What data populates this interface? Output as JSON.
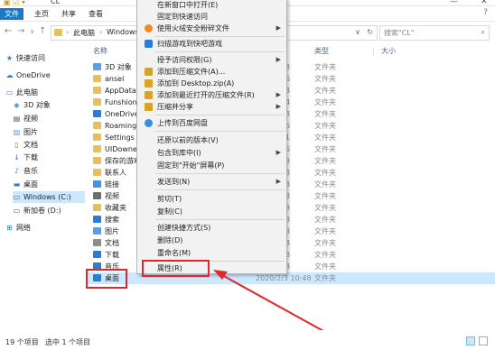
{
  "window": {
    "title": "CL",
    "minimize": "—",
    "close": "✕"
  },
  "ribbon": {
    "tabs": [
      "文件",
      "主页",
      "共享",
      "查看"
    ],
    "help": "?"
  },
  "address": {
    "crumbs": [
      "此电脑",
      "Windows"
    ],
    "search_placeholder": "搜索\"CL\""
  },
  "navpane": {
    "items": [
      {
        "label": "快速访问",
        "icon": "star-icon"
      },
      {
        "label": "OneDrive",
        "icon": "cloud-icon"
      },
      {
        "label": "此电脑",
        "icon": "computer-icon"
      },
      {
        "label": "3D 对象",
        "icon": "cube-icon"
      },
      {
        "label": "视频",
        "icon": "video-icon"
      },
      {
        "label": "图片",
        "icon": "picture-icon"
      },
      {
        "label": "文档",
        "icon": "document-icon"
      },
      {
        "label": "下载",
        "icon": "download-icon"
      },
      {
        "label": "音乐",
        "icon": "music-icon"
      },
      {
        "label": "桌面",
        "icon": "desktop-icon"
      },
      {
        "label": "Windows (C:)",
        "icon": "drive-icon"
      },
      {
        "label": "新加卷 (D:)",
        "icon": "drive-icon"
      },
      {
        "label": "网络",
        "icon": "network-icon"
      }
    ]
  },
  "columns": {
    "name": "名称",
    "type": "类型",
    "size": "大小"
  },
  "files": [
    {
      "name": "3D 对象",
      "tail": "3",
      "type": "文件夹",
      "color": "#5aa0e0"
    },
    {
      "name": "ansel",
      "tail": "6",
      "type": "文件夹",
      "color": "#e8c05b"
    },
    {
      "name": "AppData",
      "tail": "3",
      "type": "文件夹",
      "color": "#e8c05b"
    },
    {
      "name": "Funshion",
      "tail": "4",
      "type": "文件夹",
      "color": "#e8c05b"
    },
    {
      "name": "OneDrive",
      "tail": "3",
      "type": "文件夹",
      "color": "#2b7cd3"
    },
    {
      "name": "Roaming",
      "tail": "6",
      "type": "文件夹",
      "color": "#e8c05b"
    },
    {
      "name": "Settings",
      "tail": "1",
      "type": "文件夹",
      "color": "#e8c05b"
    },
    {
      "name": "UIDowner",
      "tail": "6",
      "type": "文件夹",
      "color": "#e8c05b"
    },
    {
      "name": "保存的游戏",
      "tail": "3",
      "type": "文件夹",
      "color": "#e8c05b"
    },
    {
      "name": "联系人",
      "tail": "3",
      "type": "文件夹",
      "color": "#e8c05b"
    },
    {
      "name": "链接",
      "tail": "3",
      "type": "文件夹",
      "color": "#4a90d9"
    },
    {
      "name": "视频",
      "tail": "3",
      "type": "文件夹",
      "color": "#6d6d6d"
    },
    {
      "name": "收藏夹",
      "tail": "3",
      "type": "文件夹",
      "color": "#e8c05b"
    },
    {
      "name": "搜索",
      "tail": "3",
      "type": "文件夹",
      "color": "#2b7cd3"
    },
    {
      "name": "图片",
      "tail": "3",
      "type": "文件夹",
      "color": "#5aa0e0"
    },
    {
      "name": "文档",
      "tail": "3",
      "type": "文件夹",
      "color": "#8c8c8c"
    },
    {
      "name": "下载",
      "tail": "3",
      "type": "文件夹",
      "color": "#2b7cd3"
    },
    {
      "name": "音乐",
      "tail": "3",
      "type": "文件夹",
      "color": "#2b7cd3"
    },
    {
      "name": "桌面",
      "date": "2020/2/3 10:48",
      "type": "文件夹",
      "color": "#2b7cd3"
    }
  ],
  "context_menu": {
    "items": [
      {
        "label": "在新窗口中打开(E)",
        "icon": "",
        "submenu": false
      },
      {
        "label": "固定到快速访问",
        "icon": "",
        "submenu": false
      },
      {
        "label": "使用火绒安全粉碎文件",
        "icon": "shield-icon",
        "submenu": true
      },
      {
        "label": "扫描游戏到快吧游戏",
        "icon": "game-icon",
        "submenu": false
      },
      {
        "label": "授予访问权限(G)",
        "icon": "",
        "submenu": true
      },
      {
        "label": "添加到压缩文件(A)...",
        "icon": "archive-icon",
        "submenu": false
      },
      {
        "label": "添加到 Desktop.zip(A)",
        "icon": "archive-icon",
        "submenu": false
      },
      {
        "label": "添加到最近打开的压缩文件(R)",
        "icon": "archive-icon",
        "submenu": true
      },
      {
        "label": "压缩并分享",
        "icon": "archive-icon",
        "submenu": true
      },
      {
        "label": "上传到百度网盘",
        "icon": "cloud-upload-icon",
        "submenu": false
      },
      {
        "label": "还原以前的版本(V)",
        "icon": "",
        "submenu": false
      },
      {
        "label": "包含到库中(I)",
        "icon": "",
        "submenu": true
      },
      {
        "label": "固定到\"开始\"屏幕(P)",
        "icon": "",
        "submenu": false
      },
      {
        "label": "发送到(N)",
        "icon": "",
        "submenu": true
      },
      {
        "label": "剪切(T)",
        "icon": "",
        "submenu": false
      },
      {
        "label": "复制(C)",
        "icon": "",
        "submenu": false
      },
      {
        "label": "创建快捷方式(S)",
        "icon": "",
        "submenu": false
      },
      {
        "label": "删除(D)",
        "icon": "",
        "submenu": false
      },
      {
        "label": "重命名(M)",
        "icon": "",
        "submenu": false
      },
      {
        "label": "属性(R)",
        "icon": "",
        "submenu": false
      }
    ]
  },
  "status": {
    "count": "19 个项目",
    "selected": "选中 1 个项目"
  },
  "colors": {
    "selection": "#cce8ff",
    "highlight": "#e0282c",
    "file_tab": "#1979ca"
  }
}
